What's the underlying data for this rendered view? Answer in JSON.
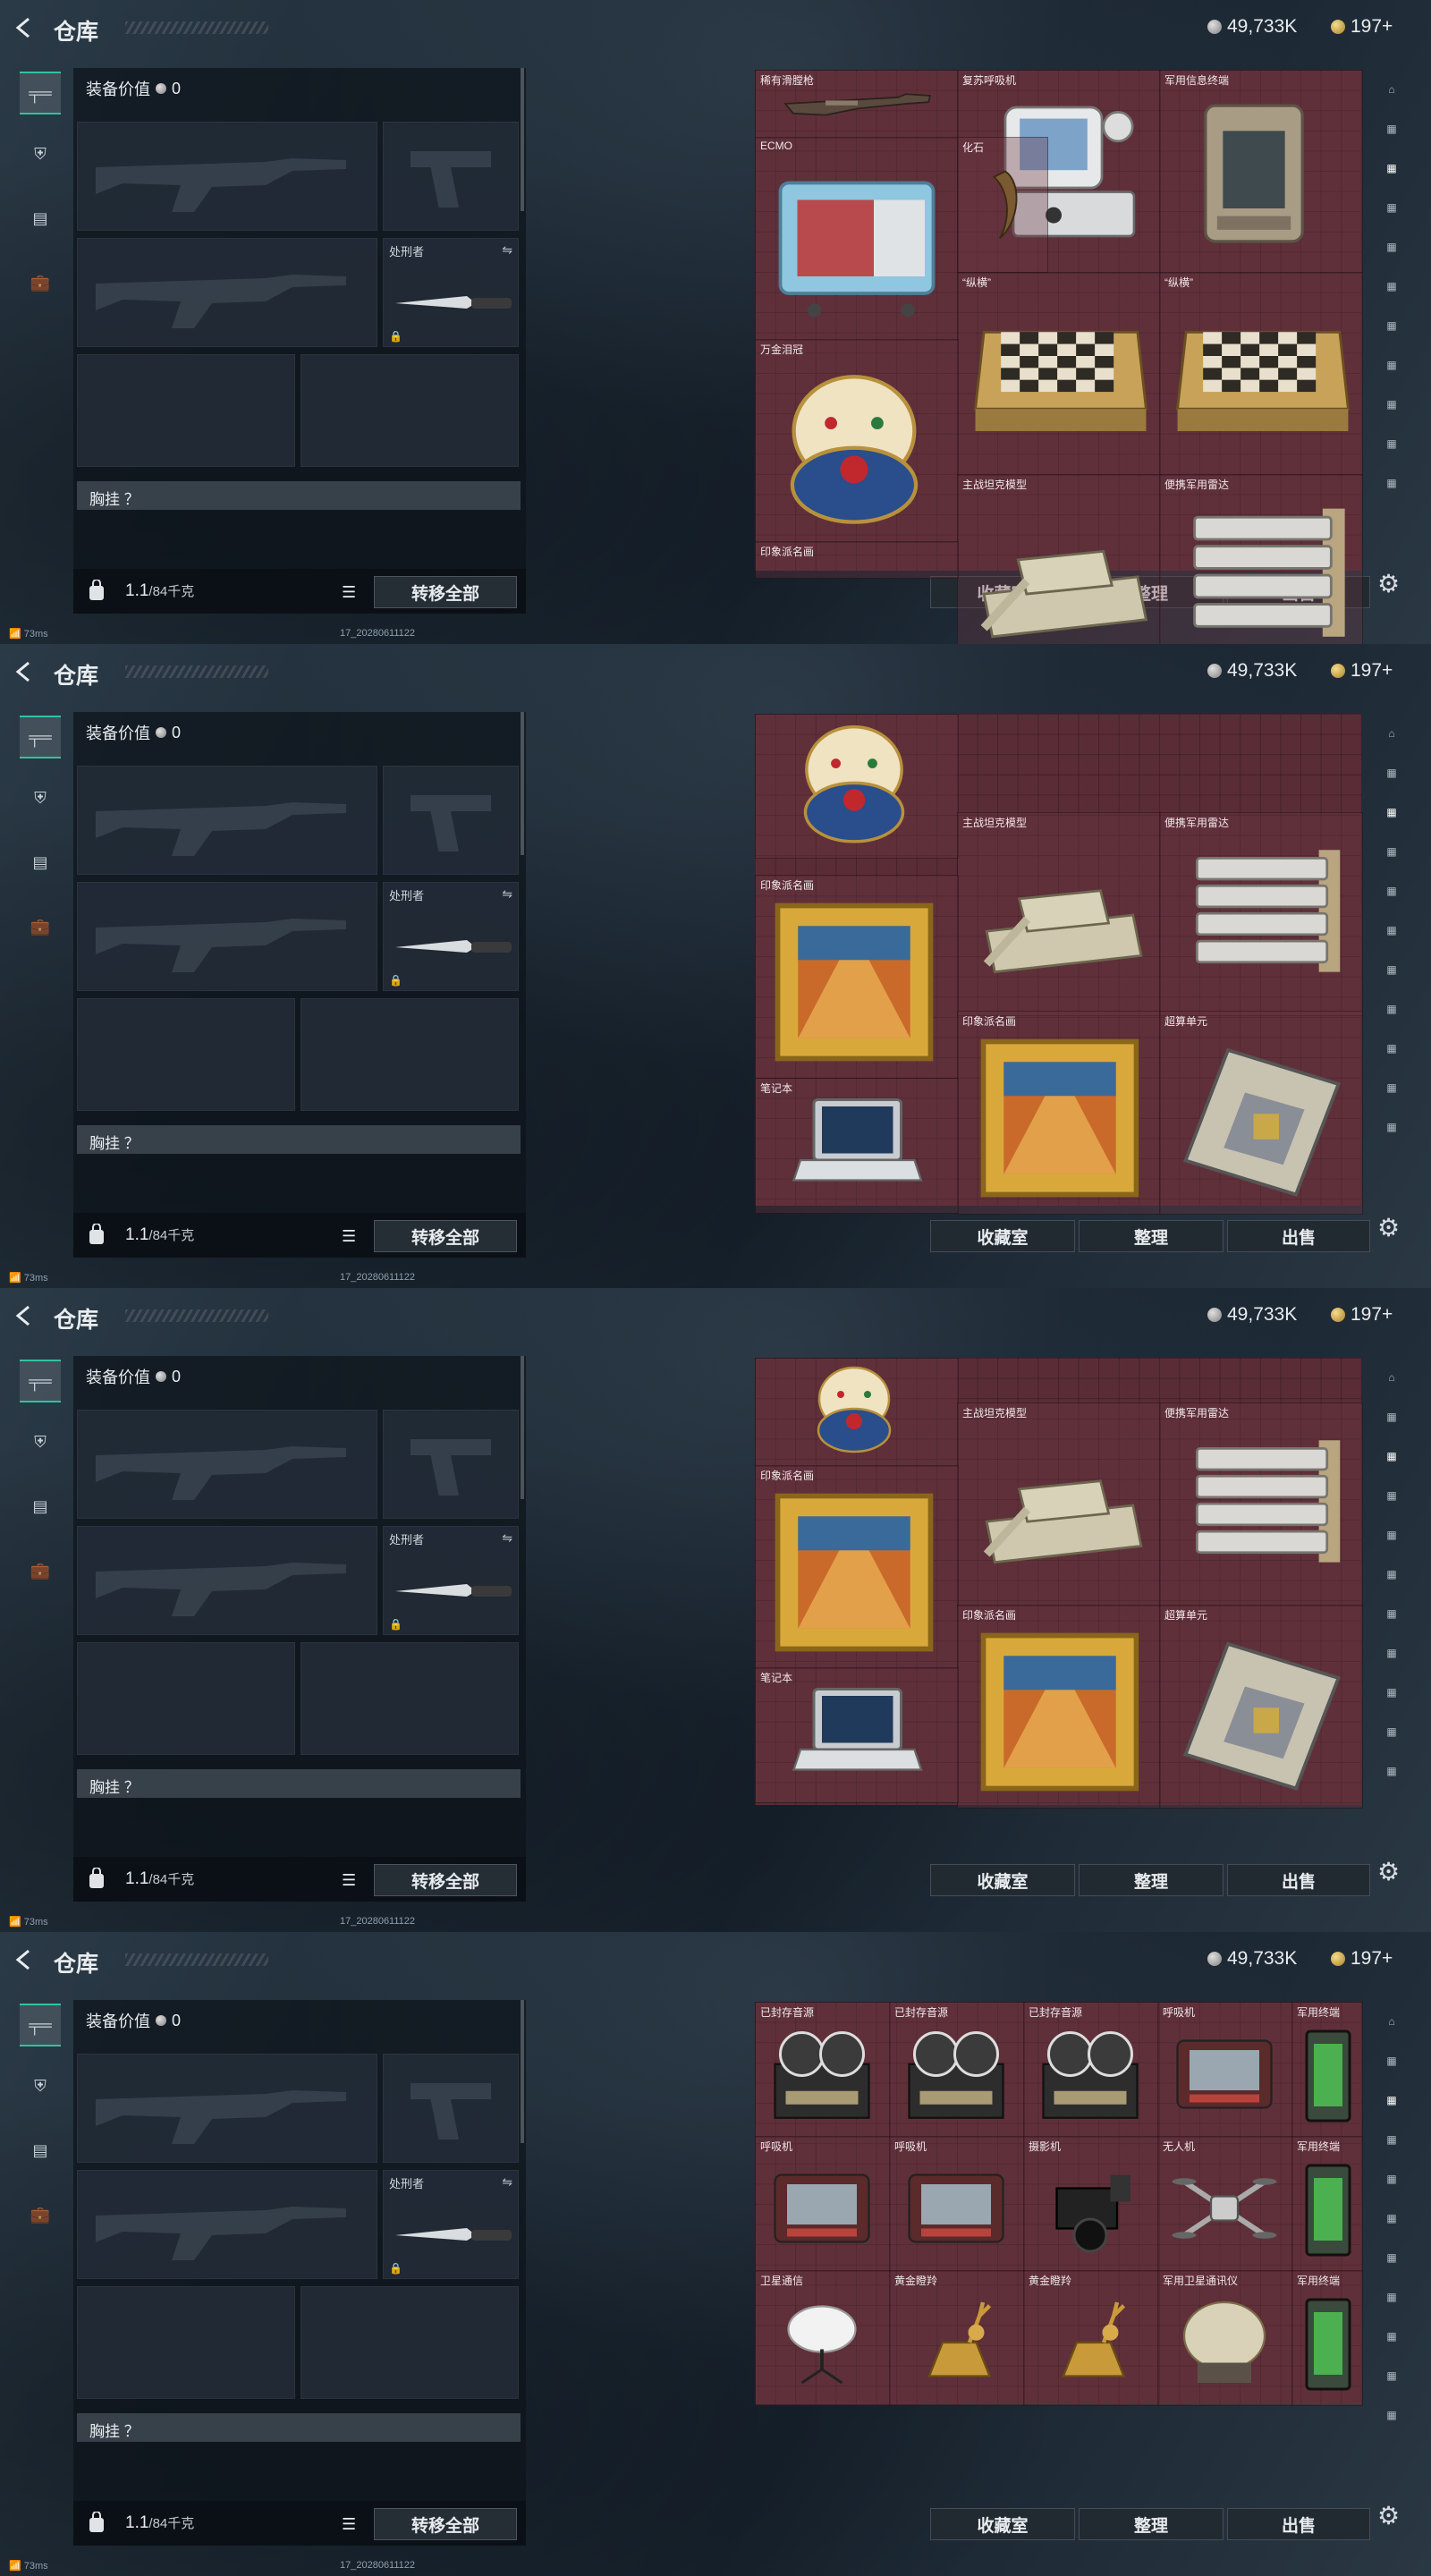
{
  "app": {
    "title": "仓库",
    "silver_amount": "49,733K",
    "gold_amount": "197+",
    "ping": "73ms",
    "build": "17_20280611122"
  },
  "loadout": {
    "equip_value_label": "装备价值",
    "equip_value": "0",
    "melee_slot_label": "处刑者",
    "chest_label": "胸挂 ？",
    "weight": "1.1",
    "weight_cap": "/84千克",
    "transfer_all": "转移全部"
  },
  "actions": {
    "collection": "收藏室",
    "sort": "整理",
    "sell": "出售"
  },
  "screens": [
    {
      "items": [
        {
          "label": "稀有滑膛枪",
          "icon": "musket-icon"
        },
        {
          "label": "复苏呼吸机",
          "icon": "ventilator-icon"
        },
        {
          "label": "军用信息终端",
          "icon": "military-terminal-icon"
        },
        {
          "label": "ECMO",
          "icon": "ecmo-icon"
        },
        {
          "label": "化石",
          "icon": "fossil-icon"
        },
        {
          "label": "“纵横”",
          "icon": "chessboard-icon"
        },
        {
          "label": "“纵横”",
          "icon": "chessboard-icon"
        },
        {
          "label": "万金泪冠",
          "icon": "egg-icon"
        },
        {
          "label": "主战坦克模型",
          "icon": "tank-icon"
        },
        {
          "label": "便携军用雷达",
          "icon": "radar-icon"
        },
        {
          "label": "印象派名画",
          "icon": "painting-icon"
        }
      ]
    },
    {
      "items": [
        {
          "label": "",
          "icon": "egg-icon"
        },
        {
          "label": "主战坦克模型",
          "icon": "tank-icon"
        },
        {
          "label": "便携军用雷达",
          "icon": "radar-icon"
        },
        {
          "label": "印象派名画",
          "icon": "painting-icon"
        },
        {
          "label": "印象派名画",
          "icon": "painting-icon"
        },
        {
          "label": "超算单元",
          "icon": "supercomputer-icon"
        },
        {
          "label": "笔记本",
          "icon": "laptop-icon"
        }
      ]
    },
    {
      "items": [
        {
          "label": "",
          "icon": "egg-icon"
        },
        {
          "label": "主战坦克模型",
          "icon": "tank-icon"
        },
        {
          "label": "便携军用雷达",
          "icon": "radar-icon"
        },
        {
          "label": "印象派名画",
          "icon": "painting-icon"
        },
        {
          "label": "印象派名画",
          "icon": "painting-icon"
        },
        {
          "label": "超算单元",
          "icon": "supercomputer-icon"
        },
        {
          "label": "笔记本",
          "icon": "laptop-icon"
        }
      ]
    },
    {
      "items": [
        {
          "label": "已封存音源",
          "icon": "reel-recorder-icon"
        },
        {
          "label": "已封存音源",
          "icon": "reel-recorder-icon"
        },
        {
          "label": "已封存音源",
          "icon": "reel-recorder-icon"
        },
        {
          "label": "呼吸机",
          "icon": "respirator-icon"
        },
        {
          "label": "军用终端",
          "icon": "green-terminal-icon"
        },
        {
          "label": "呼吸机",
          "icon": "respirator-icon"
        },
        {
          "label": "呼吸机",
          "icon": "respirator-icon"
        },
        {
          "label": "摄影机",
          "icon": "camera-icon"
        },
        {
          "label": "无人机",
          "icon": "drone-icon"
        },
        {
          "label": "军用终端",
          "icon": "green-terminal-icon"
        },
        {
          "label": "卫星通信",
          "icon": "satellite-dish-icon"
        },
        {
          "label": "黄金瞪羚",
          "icon": "golden-gazelle-icon"
        },
        {
          "label": "黄金瞪羚",
          "icon": "golden-gazelle-icon"
        },
        {
          "label": "军用卫星通讯仪",
          "icon": "sat-comm-icon"
        },
        {
          "label": "军用终端",
          "icon": "green-terminal-icon"
        }
      ]
    }
  ]
}
